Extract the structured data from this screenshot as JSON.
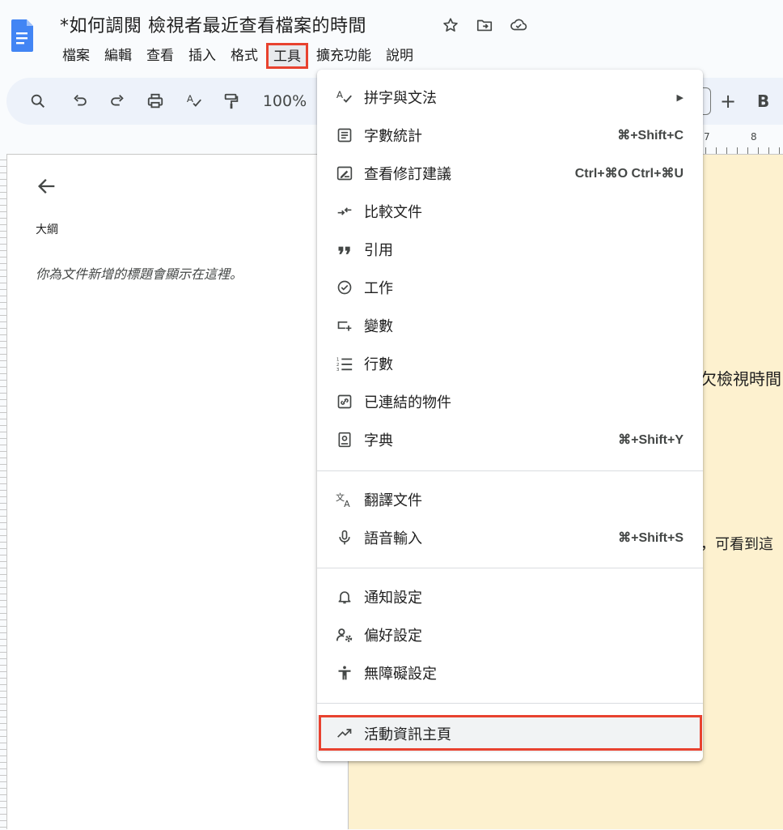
{
  "document": {
    "title": "*如何調閱 檢視者最近查看檔案的時間"
  },
  "menubar": {
    "items": [
      "檔案",
      "編輯",
      "查看",
      "插入",
      "格式",
      "工具",
      "擴充功能",
      "說明"
    ],
    "active_index": 5
  },
  "toolbar": {
    "zoom": "100%",
    "plus": "+",
    "bold": "B"
  },
  "outline": {
    "label": "大綱",
    "hint": "你為文件新增的標題會顯示在這裡。"
  },
  "ruler": {
    "n7": "7",
    "n8": "8"
  },
  "page": {
    "text1": "欠檢視時間",
    "text2": "，可看到這"
  },
  "tools_menu": {
    "items": [
      {
        "label": "拼字與文法",
        "shortcut": "",
        "submenu_arrow": "▶",
        "icon": "spellcheck-icon"
      },
      {
        "label": "字數統計",
        "shortcut": "⌘+Shift+C",
        "icon": "word-count-icon"
      },
      {
        "label": "查看修訂建議",
        "shortcut": "Ctrl+⌘O Ctrl+⌘U",
        "icon": "review-edits-icon"
      },
      {
        "label": "比較文件",
        "shortcut": "",
        "icon": "compare-icon"
      },
      {
        "label": "引用",
        "shortcut": "",
        "icon": "quote-icon"
      },
      {
        "label": "工作",
        "shortcut": "",
        "icon": "task-check-icon"
      },
      {
        "label": "變數",
        "shortcut": "",
        "icon": "variable-icon"
      },
      {
        "label": "行數",
        "shortcut": "",
        "icon": "line-numbers-icon"
      },
      {
        "label": "已連結的物件",
        "shortcut": "",
        "icon": "linked-object-icon"
      },
      {
        "label": "字典",
        "shortcut": "⌘+Shift+Y",
        "icon": "dictionary-icon"
      },
      {
        "label": "翻譯文件",
        "shortcut": "",
        "icon": "translate-icon"
      },
      {
        "label": "語音輸入",
        "shortcut": "⌘+Shift+S",
        "icon": "mic-icon"
      },
      {
        "label": "通知設定",
        "shortcut": "",
        "icon": "bell-icon"
      },
      {
        "label": "偏好設定",
        "shortcut": "",
        "icon": "preferences-icon"
      },
      {
        "label": "無障礙設定",
        "shortcut": "",
        "icon": "accessibility-icon"
      },
      {
        "label": "活動資訊主頁",
        "shortcut": "",
        "icon": "trending-up-icon"
      }
    ]
  },
  "colors": {
    "highlight_border": "#e8422f",
    "doc_blue": "#4285f4",
    "page_background": "#fdf1cf"
  }
}
